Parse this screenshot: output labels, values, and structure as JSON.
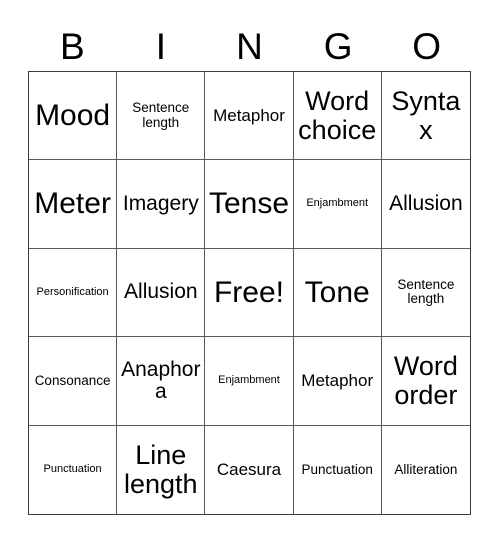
{
  "header": {
    "letters": [
      "B",
      "I",
      "N",
      "G",
      "O"
    ]
  },
  "grid": {
    "rows": 5,
    "columns": 5,
    "border_color": "#5a5a5a",
    "outer_border_color": "#3b3b3b",
    "background_color": "#ffffff",
    "text_color": "#000000",
    "cells": [
      {
        "label": "Mood",
        "size": "fs-xl",
        "free": false
      },
      {
        "label": "Sentence length",
        "size": "fs-xs",
        "free": false
      },
      {
        "label": "Metaphor",
        "size": "fs-sm",
        "free": false
      },
      {
        "label": "Word choice",
        "size": "fs-lg",
        "free": false
      },
      {
        "label": "Syntax",
        "size": "fs-lg",
        "free": false
      },
      {
        "label": "Meter",
        "size": "fs-xl",
        "free": false
      },
      {
        "label": "Imagery",
        "size": "fs-md",
        "free": false
      },
      {
        "label": "Tense",
        "size": "fs-xl",
        "free": false
      },
      {
        "label": "Enjambment",
        "size": "fs-xxs",
        "free": false
      },
      {
        "label": "Allusion",
        "size": "fs-md",
        "free": false
      },
      {
        "label": "Personification",
        "size": "fs-xxs",
        "free": false
      },
      {
        "label": "Allusion",
        "size": "fs-md",
        "free": false
      },
      {
        "label": "Free!",
        "size": "fs-xl",
        "free": true
      },
      {
        "label": "Tone",
        "size": "fs-xl",
        "free": false
      },
      {
        "label": "Sentence length",
        "size": "fs-xs",
        "free": false
      },
      {
        "label": "Consonance",
        "size": "fs-xs",
        "free": false
      },
      {
        "label": "Anaphora",
        "size": "fs-md",
        "free": false
      },
      {
        "label": "Enjambment",
        "size": "fs-xxs",
        "free": false
      },
      {
        "label": "Metaphor",
        "size": "fs-sm",
        "free": false
      },
      {
        "label": "Word order",
        "size": "fs-lg",
        "free": false
      },
      {
        "label": "Punctuation",
        "size": "fs-xxs",
        "free": false
      },
      {
        "label": "Line length",
        "size": "fs-lg",
        "free": false
      },
      {
        "label": "Caesura",
        "size": "fs-sm",
        "free": false
      },
      {
        "label": "Punctuation",
        "size": "fs-xs",
        "free": false
      },
      {
        "label": "Alliteration",
        "size": "fs-xs",
        "free": false
      }
    ]
  }
}
